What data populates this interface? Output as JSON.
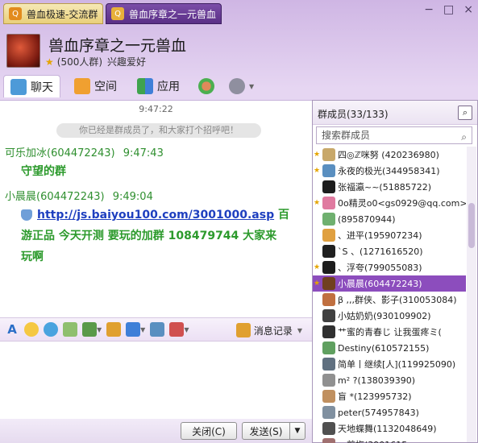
{
  "tabs": [
    {
      "label": "兽血极速-交流群"
    },
    {
      "label": "兽血序章之一元兽血"
    }
  ],
  "window_controls": {
    "min": "−",
    "max": "□",
    "close": "×"
  },
  "header": {
    "title": "兽血序章之一元兽血",
    "group_size": "(500人群)",
    "category": "兴趣爱好"
  },
  "toolbar": {
    "chat": "聊天",
    "space": "空间",
    "apps": "应用"
  },
  "chat": {
    "top_time": "9:47:22",
    "system_message": "你已经是群成员了，和大家打个招呼吧！",
    "messages": [
      {
        "sender": "可乐加冰(604472243)",
        "time": "9:47:43",
        "text": "守望的群"
      },
      {
        "sender": "小晨晨(604472243)",
        "time": "9:49:04",
        "link": "http://js.baiyou100.com/3001000.asp",
        "text_after_link": "百",
        "line2": "游正品 今天开测 要玩的加群 108479744 大家来",
        "line3": "玩啊"
      }
    ]
  },
  "inputbar": {
    "history": "消息记录"
  },
  "buttons": {
    "close": "关闭(C)",
    "send": "发送(S)"
  },
  "members": {
    "title": "群成员(33/133)",
    "search_placeholder": "搜索群成员",
    "list": [
      {
        "name": "四◎ℤ咪努 (420236980)",
        "star": true,
        "color": "#c8a86a"
      },
      {
        "name": "永夜的极光(344958341)",
        "star": true,
        "color": "#5a8fc0"
      },
      {
        "name": "张福瀛~~(51885722)",
        "star": false,
        "color": "#1d1d1d"
      },
      {
        "name": "0o精灵o0<gs0929@qq.com>",
        "star": true,
        "color": "#e07aa0"
      },
      {
        "name": "(895870944)",
        "star": false,
        "color": "#6fb06f"
      },
      {
        "name": "、进平(195907234)",
        "star": false,
        "color": "#e0a040"
      },
      {
        "name": "`S 、(1271616520)",
        "star": false,
        "color": "#202020"
      },
      {
        "name": "、浮夸(799055083)",
        "star": true,
        "color": "#1d1d1d"
      },
      {
        "name": "小晨晨(604472243)",
        "star": true,
        "color": "#704020",
        "selected": true
      },
      {
        "name": "β ,,,群侠、影子(310053084)",
        "star": false,
        "color": "#c07040"
      },
      {
        "name": "小姑奶奶(930109902)",
        "star": false,
        "color": "#404040"
      },
      {
        "name": "艹蜜的青春じ 让我蛋疼ミ(",
        "star": false,
        "color": "#303030"
      },
      {
        "name": "Destiny(610572155)",
        "star": false,
        "color": "#60a060"
      },
      {
        "name": "简单丨继续[人](119925090)",
        "star": false,
        "color": "#607080"
      },
      {
        "name": "m² ?(138039390)",
        "star": false,
        "color": "#909090"
      },
      {
        "name": "盲 *(123995732)",
        "star": false,
        "color": "#c09060"
      },
      {
        "name": "peter(574957843)",
        "star": false,
        "color": "#8090a0"
      },
      {
        "name": "天地蝶舞(1132048649)",
        "star": false,
        "color": "#505050"
      },
      {
        "name": "一剪梅(3901615",
        "star": false,
        "color": "#a07070"
      }
    ]
  }
}
